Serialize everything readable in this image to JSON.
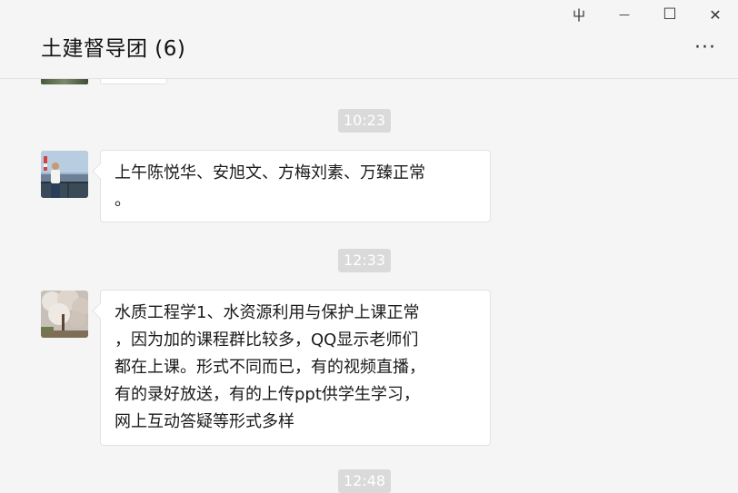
{
  "window": {
    "controls": {
      "pin": "⼬",
      "minimize": "—",
      "maximize": "☐",
      "close": "✕"
    }
  },
  "header": {
    "title": "土建督导团 (6)",
    "more": "···"
  },
  "messages": [
    {
      "time": "10:23",
      "text": "上午陈悦华、安旭文、方梅刘素、万臻正常\n。"
    },
    {
      "time": "12:33",
      "text": "水质工程学1、水资源利用与保护上课正常\n，因为加的课程群比较多，QQ显示老师们\n都在上课。形式不同而已，有的视频直播，\n有的录好放送，有的上传ppt供学生学习，\n网上互动答疑等形式多样"
    },
    {
      "time": "12:48"
    }
  ],
  "colors": {
    "background": "#f5f5f5",
    "bubble": "#ffffff",
    "time_badge": "#dadada"
  }
}
